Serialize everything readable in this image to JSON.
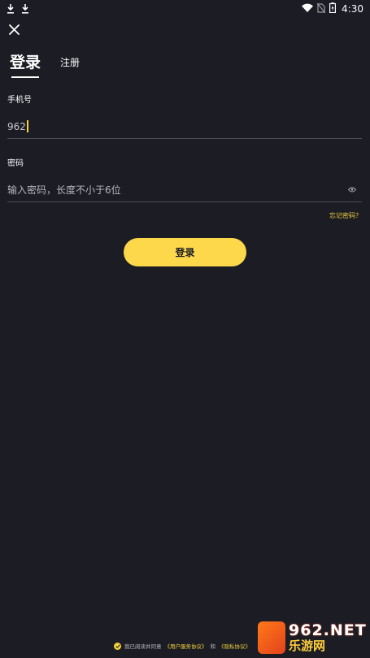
{
  "status_bar": {
    "time": "4:30",
    "left_icons": [
      "download-icon",
      "download-icon"
    ],
    "right_icons": [
      "wifi-icon",
      "no-sim-icon",
      "battery-icon"
    ]
  },
  "header": {
    "close_icon": "close-icon"
  },
  "tabs": {
    "login_label": "登录",
    "register_label": "注册"
  },
  "form": {
    "phone_label": "手机号",
    "phone_value": "962",
    "password_label": "密码",
    "password_placeholder": "输入密码，长度不小于6位",
    "eye_icon": "eye-icon",
    "forgot_label": "忘记密码？"
  },
  "actions": {
    "login_button": "登录"
  },
  "agreement": {
    "prefix": "我已阅读并同意",
    "user_agreement": "《用户服务协议》",
    "and": "和",
    "privacy_policy": "《隐私协议》"
  },
  "watermark": {
    "top": "962.NET",
    "bottom": "乐游网"
  },
  "colors": {
    "background": "#1b1c24",
    "accent": "#fdd84a",
    "divider": "#4a4b55"
  }
}
